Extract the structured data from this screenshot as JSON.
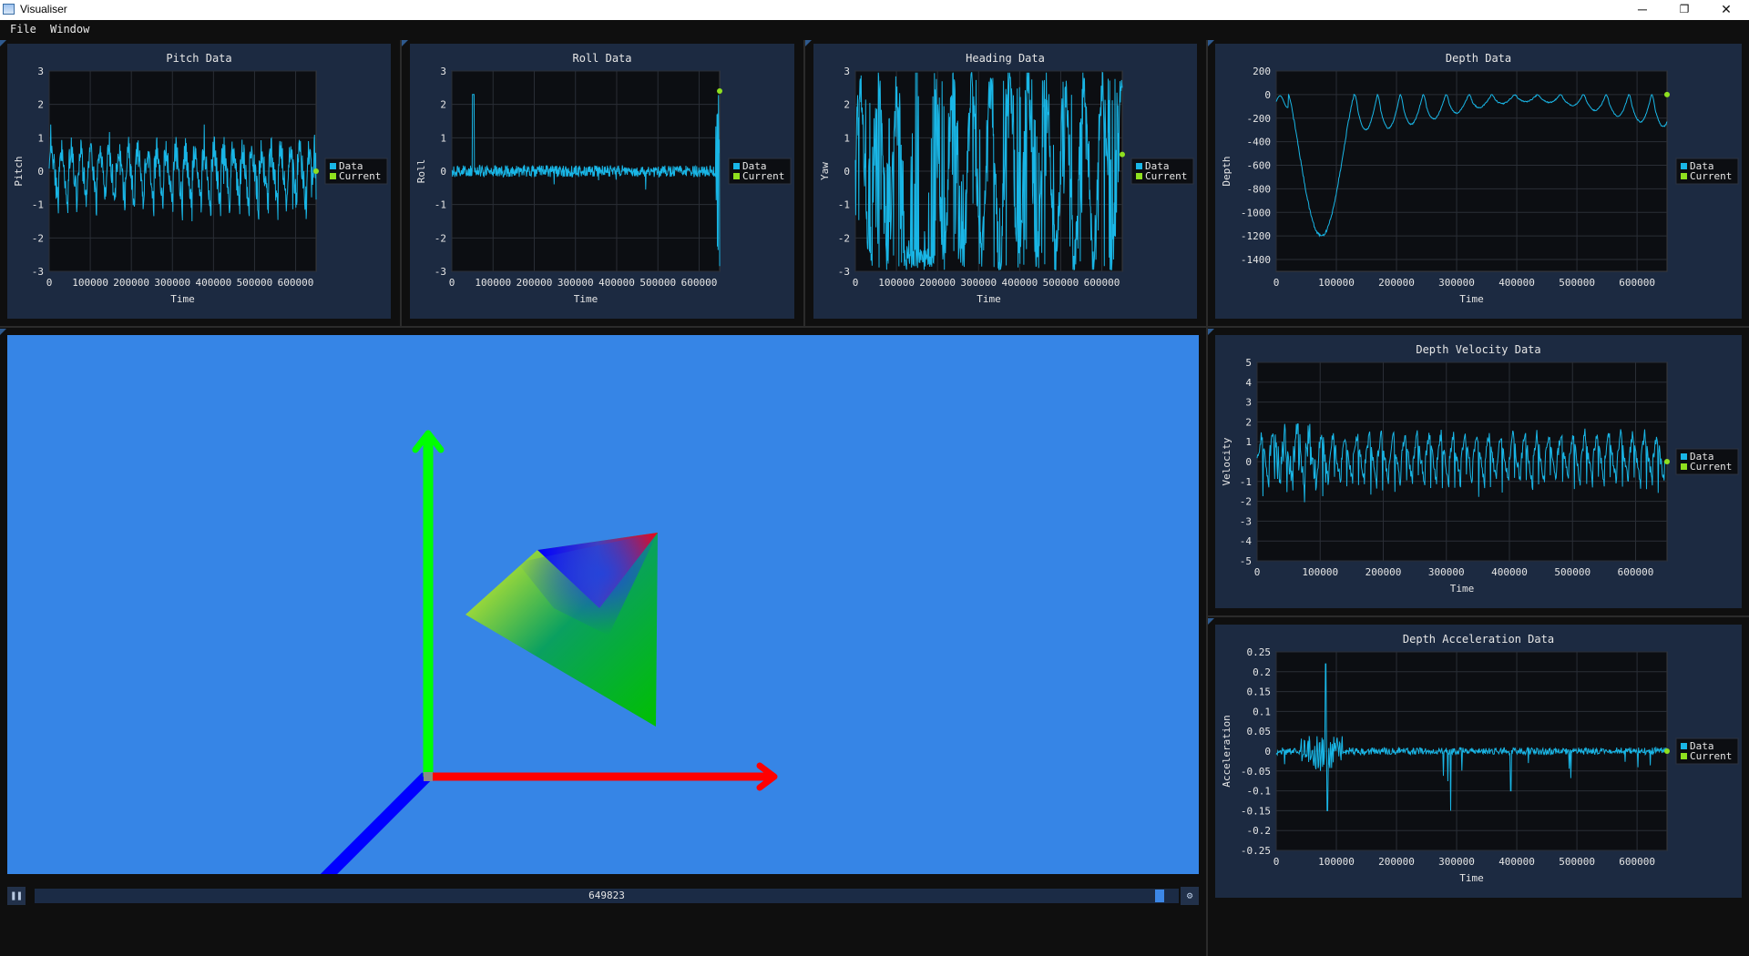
{
  "window": {
    "title": "Visualiser",
    "minimize": "─",
    "restore": "❐",
    "close": "✕"
  },
  "menu": [
    "File",
    "Window"
  ],
  "legend": {
    "data_label": "Data",
    "current_label": "Current",
    "data_color": "#19b6e6",
    "current_color": "#8fe01f"
  },
  "timeline": {
    "value": "649823",
    "pause_icon": "pause-icon",
    "settings_icon": "settings-icon"
  },
  "colors": {
    "panel": "#1c2a41",
    "plot": "#0c0e12",
    "line": "#19b6e6",
    "viewport": "#3685e6",
    "x_axis": "#ff0000",
    "y_axis": "#00ff00",
    "z_axis": "#0000ff"
  },
  "chart_data": [
    {
      "id": "pitch",
      "type": "line",
      "title": "Pitch Data",
      "xlabel": "Time",
      "ylabel": "Pitch",
      "xlim": [
        0,
        649823
      ],
      "ylim": [
        -3,
        3
      ],
      "xticks": [
        "0",
        "100000",
        "200000",
        "300000",
        "400000",
        "500000",
        "600000"
      ],
      "yticks": [
        "3",
        "2",
        "1",
        "0",
        "-1",
        "-2",
        "-3"
      ],
      "legend": "right",
      "pattern": "pitch",
      "current": 0
    },
    {
      "id": "roll",
      "type": "line",
      "title": "Roll Data",
      "xlabel": "Time",
      "ylabel": "Roll",
      "xlim": [
        0,
        649823
      ],
      "ylim": [
        -3,
        3
      ],
      "xticks": [
        "0",
        "100000",
        "200000",
        "300000",
        "400000",
        "500000",
        "600000"
      ],
      "yticks": [
        "3",
        "2",
        "1",
        "0",
        "-1",
        "-2",
        "-3"
      ],
      "legend": "right",
      "pattern": "roll",
      "current": 2.4
    },
    {
      "id": "heading",
      "type": "line",
      "title": "Heading Data",
      "xlabel": "Time",
      "ylabel": "Yaw",
      "xlim": [
        0,
        649823
      ],
      "ylim": [
        -3,
        3
      ],
      "xticks": [
        "0",
        "100000",
        "200000",
        "300000",
        "400000",
        "500000",
        "600000"
      ],
      "yticks": [
        "3",
        "2",
        "1",
        "0",
        "-1",
        "-2",
        "-3"
      ],
      "legend": "right",
      "pattern": "heading",
      "current": 0.5
    },
    {
      "id": "depth",
      "type": "line",
      "title": "Depth Data",
      "xlabel": "Time",
      "ylabel": "Depth",
      "xlim": [
        0,
        649823
      ],
      "ylim": [
        -1500,
        200
      ],
      "xticks": [
        "0",
        "100000",
        "200000",
        "300000",
        "400000",
        "500000",
        "600000"
      ],
      "yticks": [
        "200",
        "0",
        "-200",
        "-400",
        "-600",
        "-800",
        "-1000",
        "-1200",
        "-1400"
      ],
      "legend": "right",
      "pattern": "depth",
      "current": 0
    },
    {
      "id": "velocity",
      "type": "line",
      "title": "Depth Velocity Data",
      "xlabel": "Time",
      "ylabel": "Velocity",
      "xlim": [
        0,
        649823
      ],
      "ylim": [
        -5,
        5
      ],
      "xticks": [
        "0",
        "100000",
        "200000",
        "300000",
        "400000",
        "500000",
        "600000"
      ],
      "yticks": [
        "5",
        "4",
        "3",
        "2",
        "1",
        "0",
        "-1",
        "-2",
        "-3",
        "-4",
        "-5"
      ],
      "legend": "right",
      "pattern": "velocity",
      "current": 0
    },
    {
      "id": "acceleration",
      "type": "line",
      "title": "Depth Acceleration Data",
      "xlabel": "Time",
      "ylabel": "Acceleration",
      "xlim": [
        0,
        649823
      ],
      "ylim": [
        -0.25,
        0.25
      ],
      "xticks": [
        "0",
        "100000",
        "200000",
        "300000",
        "400000",
        "500000",
        "600000"
      ],
      "yticks": [
        "0.25",
        "0.2",
        "0.15",
        "0.1",
        "0.05",
        "0",
        "-0.05",
        "-0.1",
        "-0.15",
        "-0.2",
        "-0.25"
      ],
      "legend": "right",
      "pattern": "acceleration",
      "current": 0
    }
  ]
}
